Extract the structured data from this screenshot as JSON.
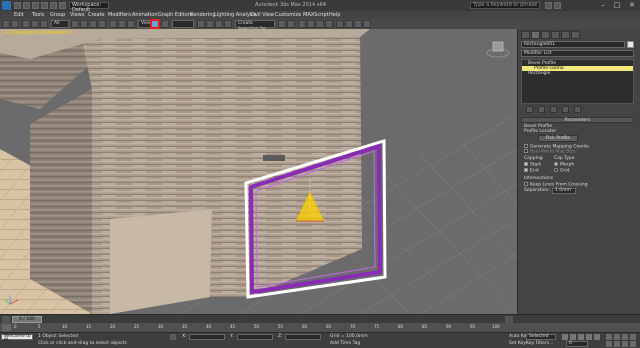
{
  "titlebar": {
    "workspace": "Workspace: Default",
    "doc_title": "Autodesk 3ds Max 2014 x64",
    "search_placeholder": "Type a keyword or phrase",
    "minimize": "–",
    "maximize": "□",
    "close": "✕"
  },
  "menu": [
    "Edit",
    "Tools",
    "Group",
    "Views",
    "Create",
    "Modifiers",
    "Animation",
    "Graph Editors",
    "Rendering",
    "Lighting Analysis",
    "Civil View",
    "Customize",
    "MAXScript",
    "Help"
  ],
  "toolbar": {
    "selection_filter": "All",
    "ref_coord": "View",
    "create_selection_set": "Create Selection Se"
  },
  "viewport": {
    "label": "[+] [Perspective] [Realistic]"
  },
  "command_panel": {
    "object_name": "Rectangle001",
    "modifier_list": "Modifier List",
    "stack": [
      "Bevel Profile",
      "Profile Gizmo",
      "Rectangle"
    ],
    "parameters_title": "Parameters",
    "bevel_profile_label": "Bevel Profile",
    "profile_locator_label": "Profile Locator",
    "pick_profile": "Pick Profile",
    "gen_mapping": "Generate Mapping Coords.",
    "real_world_map": "Real-World Map Size",
    "capping_label": "Capping",
    "cap_type_label": "Cap Type",
    "start": "Start",
    "end": "End",
    "morph": "Morph",
    "grid": "Grid",
    "intersections_label": "Intersections",
    "keep_lines": "Keep Lines From Crossing",
    "separation_label": "Separation:",
    "separation_value": "1.0mm"
  },
  "timeline": {
    "frame": "0 / 100",
    "ticks": [
      "0",
      "5",
      "10",
      "15",
      "20",
      "25",
      "30",
      "35",
      "40",
      "45",
      "50",
      "55",
      "60",
      "65",
      "70",
      "75",
      "80",
      "85",
      "90",
      "95",
      "100"
    ]
  },
  "status": {
    "maxscript": "Welcome to M",
    "selected": "1 Object Selected",
    "prompt": "Click or click-and-drag to select objects",
    "x_label": "X:",
    "y_label": "Y:",
    "z_label": "Z:",
    "grid": "Grid = 100,0mm",
    "auto_key": "Auto Key",
    "selected_dropdown": "Selected",
    "set_key": "Set Key",
    "key_filters": "Key Filters...",
    "add_time_tag": "Add Time Tag",
    "frame_field": "0"
  },
  "colors": {
    "accent_yellow": "#ffd200",
    "frame_purple": "#8a2bb8",
    "highlight_red": "#e02020"
  }
}
